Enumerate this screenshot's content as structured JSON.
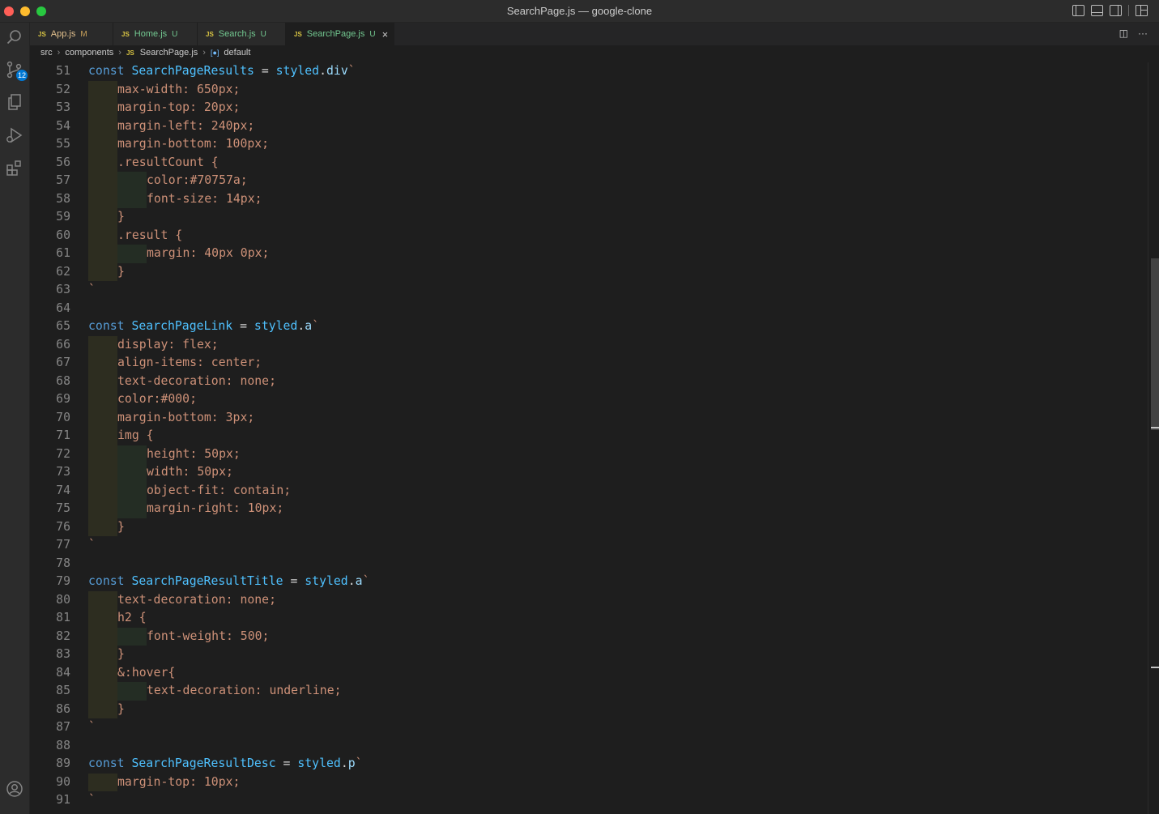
{
  "window": {
    "title": "SearchPage.js — google-clone"
  },
  "activity_bar": {
    "scm_badge": "12"
  },
  "tabs": [
    {
      "label": "App.js",
      "status": "M",
      "state": "m"
    },
    {
      "label": "Home.js",
      "status": "U",
      "state": "u"
    },
    {
      "label": "Search.js",
      "status": "U",
      "state": "u"
    },
    {
      "label": "SearchPage.js",
      "status": "U",
      "state": "u",
      "active": true
    }
  ],
  "tab_icon_text": "JS",
  "tab_actions": {
    "split": "◫",
    "more": "···"
  },
  "breadcrumb": {
    "parts": [
      "src",
      "components",
      "SearchPage.js"
    ],
    "symbol": "default"
  },
  "editor": {
    "lines": [
      {
        "n": "51",
        "indent": 0,
        "tokens": [
          [
            "kw",
            "const "
          ],
          [
            "id",
            "SearchPageResults"
          ],
          [
            "op",
            " = "
          ],
          [
            "id",
            "styled"
          ],
          [
            "op",
            "."
          ],
          [
            "fn",
            "div"
          ],
          [
            "bt",
            "`"
          ]
        ]
      },
      {
        "n": "52",
        "indent": 1,
        "tokens": [
          [
            "css",
            "max-width: 650px;"
          ]
        ]
      },
      {
        "n": "53",
        "indent": 1,
        "tokens": [
          [
            "css",
            "margin-top: 20px;"
          ]
        ]
      },
      {
        "n": "54",
        "indent": 1,
        "tokens": [
          [
            "css",
            "margin-left: 240px;"
          ]
        ]
      },
      {
        "n": "55",
        "indent": 1,
        "tokens": [
          [
            "css",
            "margin-bottom: 100px;"
          ]
        ]
      },
      {
        "n": "56",
        "indent": 1,
        "tokens": [
          [
            "css",
            ".resultCount {"
          ]
        ]
      },
      {
        "n": "57",
        "indent": 2,
        "tokens": [
          [
            "css",
            "color:#70757a;"
          ]
        ]
      },
      {
        "n": "58",
        "indent": 2,
        "tokens": [
          [
            "css",
            "font-size: 14px;"
          ]
        ]
      },
      {
        "n": "59",
        "indent": 1,
        "tokens": [
          [
            "css",
            "}"
          ]
        ]
      },
      {
        "n": "60",
        "indent": 1,
        "tokens": [
          [
            "css",
            ".result {"
          ]
        ]
      },
      {
        "n": "61",
        "indent": 2,
        "tokens": [
          [
            "css",
            "margin: 40px 0px;"
          ]
        ]
      },
      {
        "n": "62",
        "indent": 1,
        "tokens": [
          [
            "css",
            "}"
          ]
        ]
      },
      {
        "n": "63",
        "indent": 0,
        "tokens": [
          [
            "bt",
            "`"
          ]
        ]
      },
      {
        "n": "64",
        "indent": 0,
        "tokens": []
      },
      {
        "n": "65",
        "indent": 0,
        "tokens": [
          [
            "kw",
            "const "
          ],
          [
            "id",
            "SearchPageLink"
          ],
          [
            "op",
            " = "
          ],
          [
            "id",
            "styled"
          ],
          [
            "op",
            "."
          ],
          [
            "fn",
            "a"
          ],
          [
            "bt",
            "`"
          ]
        ]
      },
      {
        "n": "66",
        "indent": 1,
        "tokens": [
          [
            "css",
            "display: flex;"
          ]
        ]
      },
      {
        "n": "67",
        "indent": 1,
        "tokens": [
          [
            "css",
            "align-items: center;"
          ]
        ]
      },
      {
        "n": "68",
        "indent": 1,
        "tokens": [
          [
            "css",
            "text-decoration: none;"
          ]
        ]
      },
      {
        "n": "69",
        "indent": 1,
        "tokens": [
          [
            "css",
            "color:#000;"
          ]
        ]
      },
      {
        "n": "70",
        "indent": 1,
        "tokens": [
          [
            "css",
            "margin-bottom: 3px;"
          ]
        ]
      },
      {
        "n": "71",
        "indent": 1,
        "tokens": [
          [
            "css",
            "img {"
          ]
        ]
      },
      {
        "n": "72",
        "indent": 2,
        "tokens": [
          [
            "css",
            "height: 50px;"
          ]
        ]
      },
      {
        "n": "73",
        "indent": 2,
        "tokens": [
          [
            "css",
            "width: 50px;"
          ]
        ]
      },
      {
        "n": "74",
        "indent": 2,
        "tokens": [
          [
            "css",
            "object-fit: contain;"
          ]
        ]
      },
      {
        "n": "75",
        "indent": 2,
        "tokens": [
          [
            "css",
            "margin-right: 10px;"
          ]
        ]
      },
      {
        "n": "76",
        "indent": 1,
        "tokens": [
          [
            "css",
            "}"
          ]
        ]
      },
      {
        "n": "77",
        "indent": 0,
        "tokens": [
          [
            "bt",
            "`"
          ]
        ]
      },
      {
        "n": "78",
        "indent": 0,
        "tokens": []
      },
      {
        "n": "79",
        "indent": 0,
        "tokens": [
          [
            "kw",
            "const "
          ],
          [
            "id",
            "SearchPageResultTitle"
          ],
          [
            "op",
            " = "
          ],
          [
            "id",
            "styled"
          ],
          [
            "op",
            "."
          ],
          [
            "fn",
            "a"
          ],
          [
            "bt",
            "`"
          ]
        ]
      },
      {
        "n": "80",
        "indent": 1,
        "tokens": [
          [
            "css",
            "text-decoration: none;"
          ]
        ]
      },
      {
        "n": "81",
        "indent": 1,
        "tokens": [
          [
            "css",
            "h2 {"
          ]
        ]
      },
      {
        "n": "82",
        "indent": 2,
        "tokens": [
          [
            "css",
            "font-weight: 500;"
          ]
        ]
      },
      {
        "n": "83",
        "indent": 1,
        "tokens": [
          [
            "css",
            "}"
          ]
        ]
      },
      {
        "n": "84",
        "indent": 1,
        "tokens": [
          [
            "css",
            "&:hover{"
          ]
        ]
      },
      {
        "n": "85",
        "indent": 2,
        "tokens": [
          [
            "css",
            "text-decoration: underline;"
          ]
        ]
      },
      {
        "n": "86",
        "indent": 1,
        "tokens": [
          [
            "css",
            "}"
          ]
        ]
      },
      {
        "n": "87",
        "indent": 0,
        "tokens": [
          [
            "bt",
            "`"
          ]
        ]
      },
      {
        "n": "88",
        "indent": 0,
        "tokens": []
      },
      {
        "n": "89",
        "indent": 0,
        "tokens": [
          [
            "kw",
            "const "
          ],
          [
            "id",
            "SearchPageResultDesc"
          ],
          [
            "op",
            " = "
          ],
          [
            "id",
            "styled"
          ],
          [
            "op",
            "."
          ],
          [
            "fn",
            "p"
          ],
          [
            "bt",
            "`"
          ]
        ]
      },
      {
        "n": "90",
        "indent": 1,
        "tokens": [
          [
            "css",
            "margin-top: 10px;"
          ]
        ]
      },
      {
        "n": "91",
        "indent": 0,
        "tokens": [
          [
            "bt",
            "`"
          ]
        ]
      }
    ]
  }
}
